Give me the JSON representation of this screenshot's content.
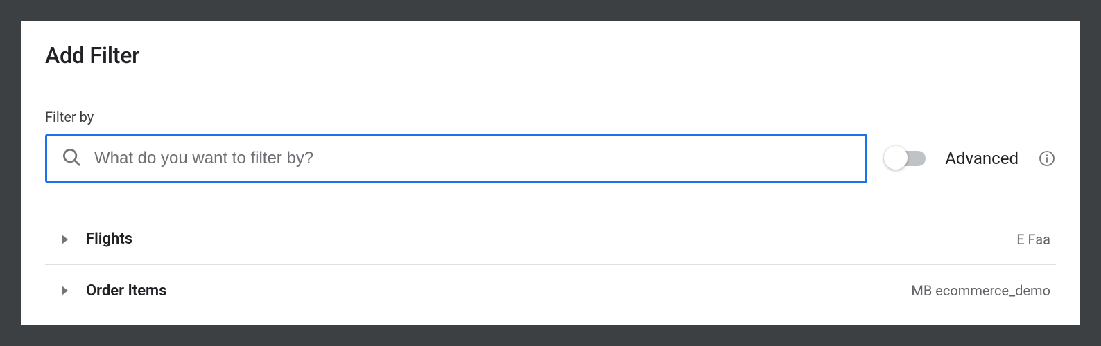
{
  "header": {
    "title": "Add Filter"
  },
  "filter": {
    "label": "Filter by",
    "placeholder": "What do you want to filter by?",
    "value": ""
  },
  "advanced": {
    "label": "Advanced",
    "on": false
  },
  "rows": [
    {
      "label": "Flights",
      "meta": "E Faa"
    },
    {
      "label": "Order Items",
      "meta": "MB ecommerce_demo"
    }
  ]
}
